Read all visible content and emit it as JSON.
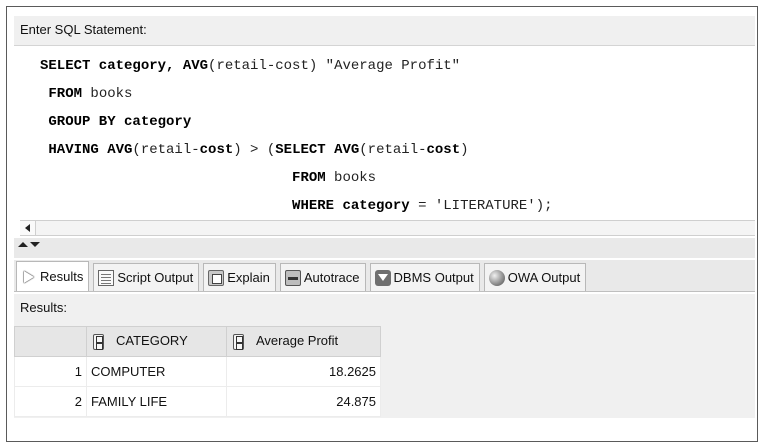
{
  "editor": {
    "label": "Enter SQL Statement:",
    "lines": [
      {
        "kw1": "SELECT category,",
        "mid1": " ",
        "kw2": "AVG",
        "rest": "(retail-cost) \"Average Profit\""
      },
      {
        "kw1": " FROM",
        "rest": " books"
      },
      {
        "kw1": " GROUP BY category",
        "rest": ""
      },
      {
        "kw1": " HAVING AVG",
        "rest": "(retail-",
        "kw2": "cost",
        "rest2": ") > (",
        "kw3": "SELECT AVG",
        "rest3": "(retail-",
        "kw4": "cost",
        "rest4": ")"
      },
      {
        "pad": "                              ",
        "kw1": "FROM",
        "rest": " books"
      },
      {
        "pad": "                              ",
        "kw1": "WHERE category",
        "rest": " = 'LITERATURE');"
      }
    ]
  },
  "tabs": [
    {
      "label": "Results",
      "icon": "play-icon"
    },
    {
      "label": "Script Output",
      "icon": "script-output-icon"
    },
    {
      "label": "Explain",
      "icon": "explain-plan-icon"
    },
    {
      "label": "Autotrace",
      "icon": "autotrace-icon"
    },
    {
      "label": "DBMS Output",
      "icon": "dbms-output-icon"
    },
    {
      "label": "OWA Output",
      "icon": "owa-globe-icon"
    }
  ],
  "results": {
    "label": "Results:",
    "columns": [
      "CATEGORY",
      "Average Profit"
    ],
    "rows": [
      {
        "num": "1",
        "category": "COMPUTER",
        "avg": "18.2625"
      },
      {
        "num": "2",
        "category": "FAMILY LIFE",
        "avg": "24.875"
      }
    ]
  }
}
